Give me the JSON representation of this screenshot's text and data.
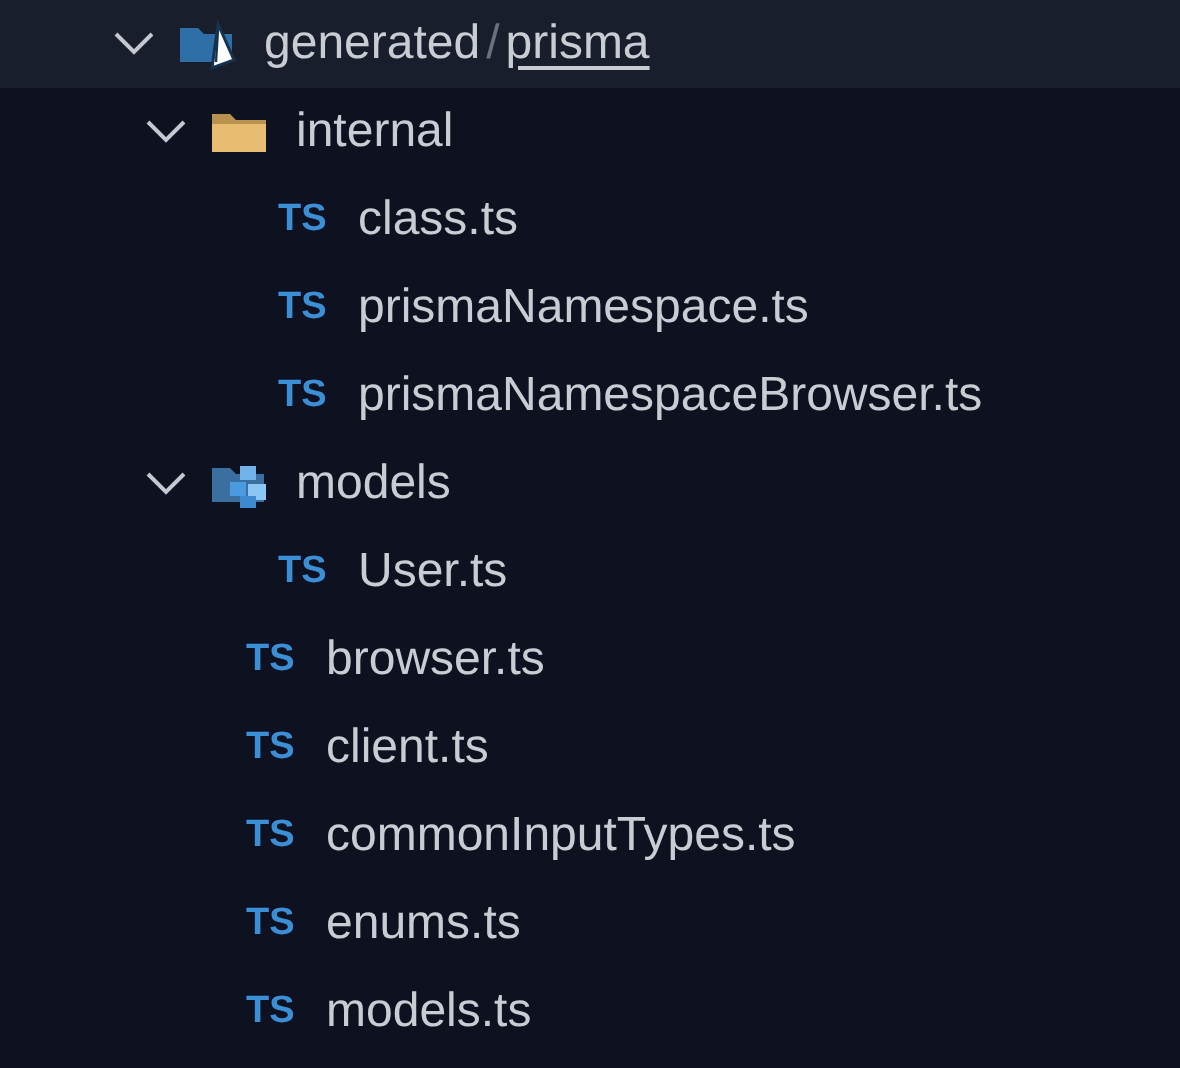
{
  "tree": [
    {
      "kind": "prisma-folder",
      "name": "generated",
      "separator": "/",
      "name_tail": "prisma",
      "expanded": true,
      "selected": true,
      "children": [
        {
          "kind": "folder",
          "name": "internal",
          "expanded": true,
          "selected": false,
          "children": [
            {
              "kind": "file",
              "badge": "TS",
              "name": "class.ts",
              "selected": false
            },
            {
              "kind": "file",
              "badge": "TS",
              "name": "prismaNamespace.ts",
              "selected": false
            },
            {
              "kind": "file",
              "badge": "TS",
              "name": "prismaNamespaceBrowser.ts",
              "selected": false
            }
          ]
        },
        {
          "kind": "models-folder",
          "name": "models",
          "expanded": true,
          "selected": false,
          "children": [
            {
              "kind": "file",
              "badge": "TS",
              "name": "User.ts",
              "selected": false
            }
          ]
        },
        {
          "kind": "file",
          "badge": "TS",
          "name": "browser.ts",
          "selected": false
        },
        {
          "kind": "file",
          "badge": "TS",
          "name": "client.ts",
          "selected": false
        },
        {
          "kind": "file",
          "badge": "TS",
          "name": "commonInputTypes.ts",
          "selected": false
        },
        {
          "kind": "file",
          "badge": "TS",
          "name": "enums.ts",
          "selected": false
        },
        {
          "kind": "file",
          "badge": "TS",
          "name": "models.ts",
          "selected": false
        }
      ]
    }
  ]
}
